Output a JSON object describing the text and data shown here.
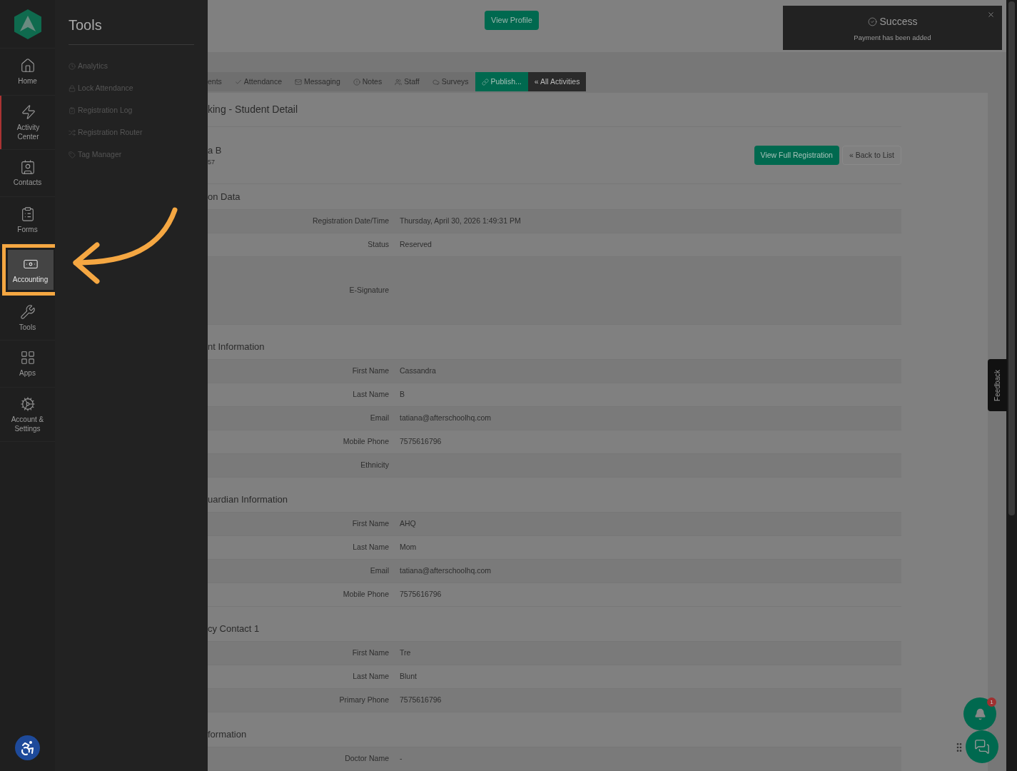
{
  "nav": {
    "items": [
      {
        "label": "Home",
        "selected": false,
        "highlighted": false
      },
      {
        "label": "Activity\nCenter",
        "selected": true,
        "highlighted": false
      },
      {
        "label": "Contacts",
        "selected": false,
        "highlighted": false
      },
      {
        "label": "Forms",
        "selected": false,
        "highlighted": false
      },
      {
        "label": "Accounting",
        "selected": false,
        "highlighted": true
      },
      {
        "label": "Tools",
        "selected": false,
        "highlighted": false
      },
      {
        "label": "Apps",
        "selected": false,
        "highlighted": false
      },
      {
        "label": "Account &\nSettings",
        "selected": false,
        "highlighted": false
      }
    ]
  },
  "flyout": {
    "title": "Tools",
    "items": [
      "Analytics",
      "Lock Attendance",
      "Registration Log",
      "Registration Router",
      "Tag Manager"
    ]
  },
  "top_bar": {
    "button": "View Profile"
  },
  "toast": {
    "title": "Success",
    "message": "Payment has been added"
  },
  "tabs": [
    {
      "label": "ents",
      "kind": "plain"
    },
    {
      "label": "Attendance",
      "kind": "plain"
    },
    {
      "label": "Messaging",
      "kind": "plain"
    },
    {
      "label": "Notes",
      "kind": "plain"
    },
    {
      "label": "Staff",
      "kind": "plain"
    },
    {
      "label": "Surveys",
      "kind": "plain"
    },
    {
      "label": "Publish...",
      "kind": "green"
    },
    {
      "label": "« All Activities",
      "kind": "dark"
    }
  ],
  "detail": {
    "title": "king - Student Detail",
    "name": "a B",
    "number": "57",
    "buttons": [
      {
        "label": "View Full Registration",
        "kind": "green"
      },
      {
        "label": "« Back to List",
        "kind": "outline"
      }
    ],
    "sections": [
      {
        "title": "on Data",
        "rows": [
          {
            "label": "Registration Date/Time",
            "value": "Thursday, April 30, 2026 1:49:31 PM"
          },
          {
            "label": "Status",
            "value": "Reserved"
          },
          {
            "label": "E-Signature",
            "kind": "signature"
          }
        ]
      },
      {
        "title": "nt Information",
        "rows": [
          {
            "label": "First Name",
            "value": "Cassandra"
          },
          {
            "label": "Last Name",
            "value": "B"
          },
          {
            "label": "Email",
            "value": "tatiana@afterschoolhq.com"
          },
          {
            "label": "Mobile Phone",
            "value": "7575616796"
          },
          {
            "label": "Ethnicity"
          }
        ]
      },
      {
        "title": "uardian Information",
        "rows": [
          {
            "label": "First Name",
            "value": "AHQ"
          },
          {
            "label": "Last Name",
            "value": "Mom"
          },
          {
            "label": "Email",
            "value": "tatiana@afterschoolhq.com"
          },
          {
            "label": "Mobile Phone",
            "value": "7575616796"
          }
        ]
      },
      {
        "title": "cy Contact 1",
        "rows": [
          {
            "label": "First Name",
            "value": "Tre"
          },
          {
            "label": "Last Name",
            "value": "Blunt"
          },
          {
            "label": "Primary Phone",
            "value": "7575616796"
          }
        ]
      },
      {
        "title": "formation",
        "rows": [
          {
            "label": "Doctor Name",
            "value": "-"
          }
        ]
      }
    ]
  },
  "feedback_tab": "Feedback",
  "notifications": {
    "count": "1"
  }
}
